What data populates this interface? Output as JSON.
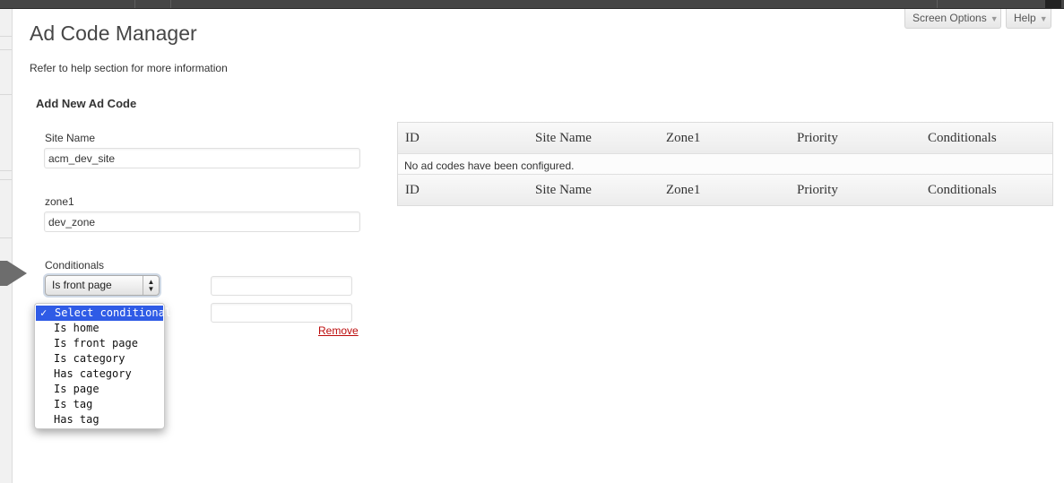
{
  "screen_options": {
    "label": "Screen Options",
    "arrow": "▼"
  },
  "help": {
    "label": "Help",
    "arrow": "▼"
  },
  "page": {
    "title": "Ad Code Manager",
    "help_note": "Refer to help section for more information",
    "section_title": "Add New Ad Code"
  },
  "form": {
    "site_name_label": "Site Name",
    "site_name_value": "acm_dev_site",
    "zone1_label": "zone1",
    "zone1_value": "dev_zone",
    "conditionals_label": "Conditionals",
    "conditional_selected": "Is front page",
    "conditional_value_1": "",
    "conditional_value_2": "",
    "remove_label": "Remove"
  },
  "dropdown": {
    "check": "✓",
    "options": [
      "Select conditional",
      "Is home",
      "Is front page",
      "Is category",
      "Has category",
      "Is page",
      "Is tag",
      "Has tag"
    ]
  },
  "table": {
    "columns": [
      "ID",
      "Site Name",
      "Zone1",
      "Priority",
      "Conditionals"
    ],
    "empty_message": "No ad codes have been configured."
  }
}
